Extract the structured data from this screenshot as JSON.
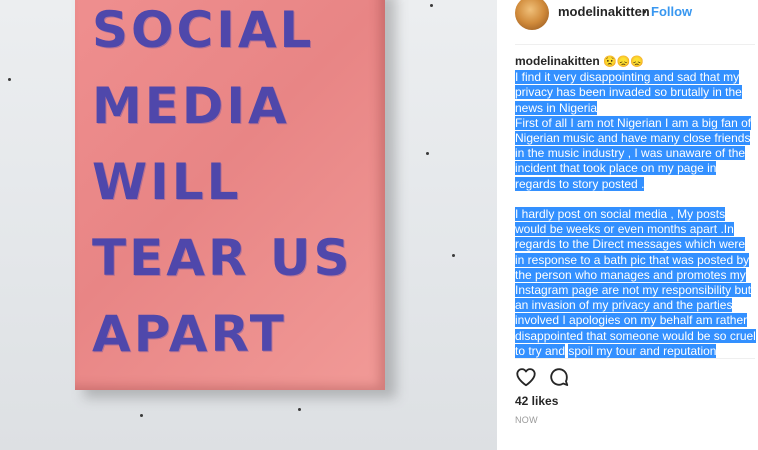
{
  "photo": {
    "sign_lines": [
      "SOCIAL",
      "MEDIA",
      "WILL",
      "TEAR US",
      "APART"
    ]
  },
  "header": {
    "username": "modelinakitten",
    "separator": "•",
    "follow_label": "Follow"
  },
  "caption": {
    "username": "modelinakitten",
    "emojis": "😟😞😞",
    "paragraph1": "I find it very disappointing and sad that my privacy has been invaded so brutally in the news in Nigeria",
    "paragraph2": "First of all I am not Nigerian I am a big fan of Nigerian music and have many close friends in the music industry , I was unaware of the incident that took place on my page in regards to story posted .",
    "paragraph3": "I hardly post on social media , My posts would be weeks or even months apart .In regards to the Direct messages which were in response to a bath pic that was posted by the person who manages and promotes my Instagram page are not my responsibility but an invasion of my privacy and the parties involved I apologies on my behalf am rather disappointed that someone would be so cruel to try and",
    "paragraph3_tail": "spoil my tour and reputation"
  },
  "actions": {
    "like_icon": "heart-icon",
    "comment_icon": "comment-bubble-icon"
  },
  "likes_text": "42 likes",
  "timestamp": "NOW"
}
